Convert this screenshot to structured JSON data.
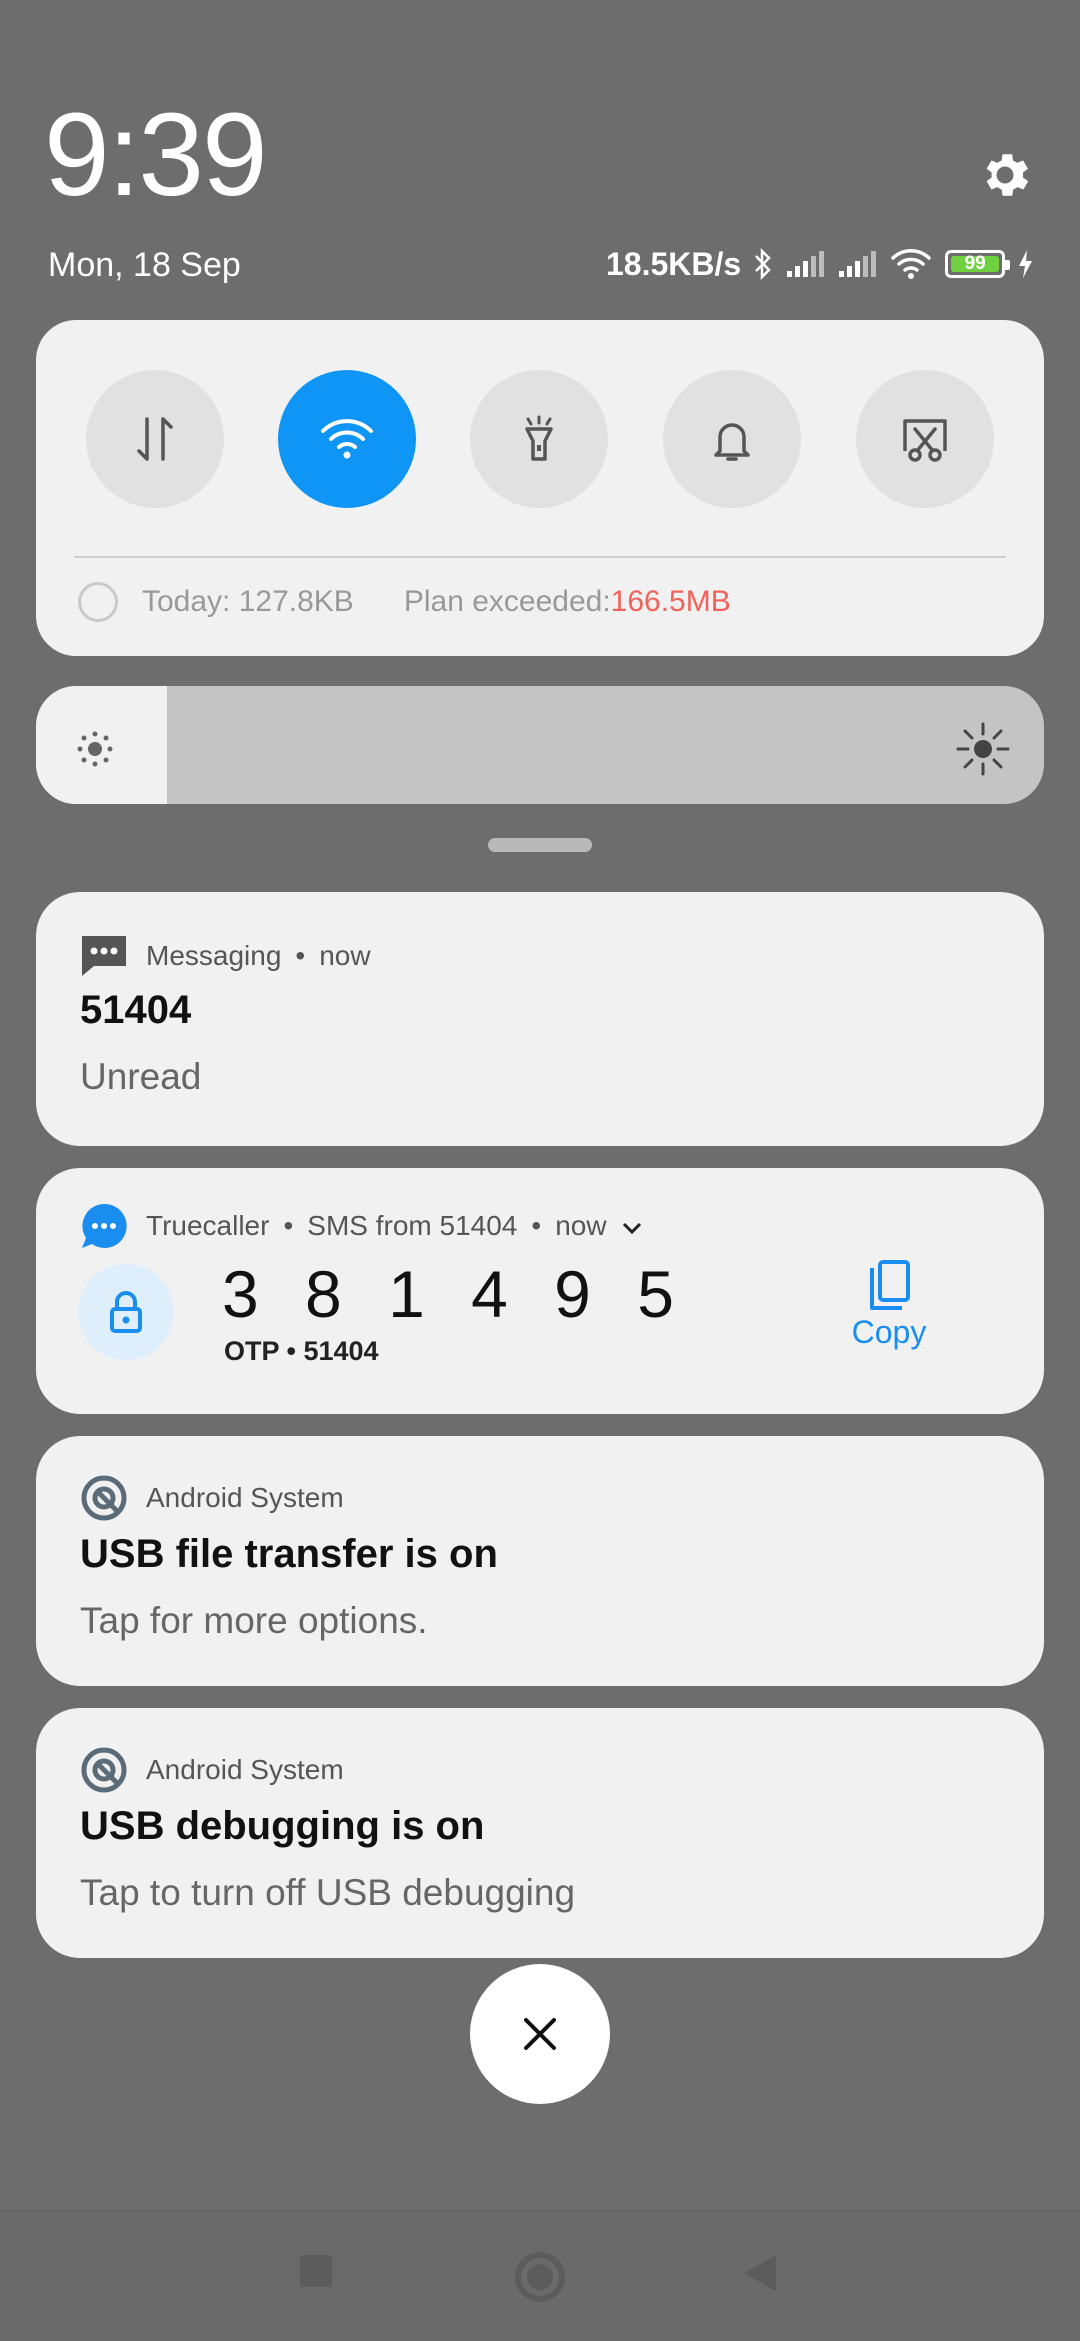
{
  "header": {
    "time": "9:39",
    "date": "Mon, 18 Sep",
    "network_speed": "18.5KB/s",
    "battery_level": "99"
  },
  "quick_settings": {
    "tiles": [
      {
        "name": "mobile-data",
        "active": false
      },
      {
        "name": "wifi",
        "active": true
      },
      {
        "name": "flashlight",
        "active": false
      },
      {
        "name": "sound",
        "active": false
      },
      {
        "name": "screenshot",
        "active": false
      }
    ],
    "today_usage": "Today: 127.8KB",
    "plan_label": "Plan exceeded: ",
    "plan_value": "166.5MB"
  },
  "brightness": {
    "level": 0.13
  },
  "notifications": {
    "messaging": {
      "app": "Messaging",
      "time": "now",
      "title": "51404",
      "body": "Unread"
    },
    "truecaller": {
      "app": "Truecaller",
      "subtitle": "SMS from 51404",
      "time": "now",
      "code": "381495",
      "code_display": "3 8 1 4 9 5",
      "otp_line": "OTP • 51404",
      "copy_label": "Copy"
    },
    "usb_transfer": {
      "app": "Android System",
      "title": "USB file transfer is on",
      "body": "Tap for more options."
    },
    "usb_debug": {
      "app": "Android System",
      "title": "USB debugging is on",
      "body": "Tap to turn off USB debugging"
    }
  },
  "colors": {
    "accent": "#0f95f6",
    "warning": "#f0625a",
    "battery": "#6fd13f"
  }
}
